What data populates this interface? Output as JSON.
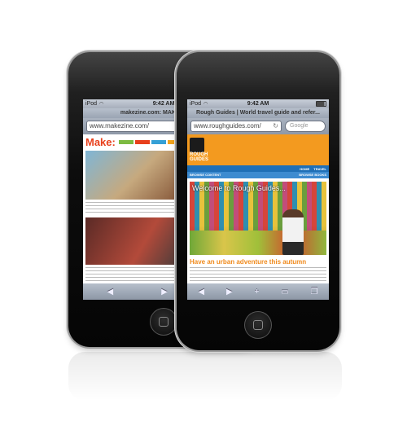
{
  "back_device": {
    "status": {
      "carrier": "iPod",
      "time": "9:42 AM"
    },
    "title": "makezine.com: MAKE: technolo",
    "url": "www.makezine.com/",
    "logo_text": "Make:"
  },
  "front_device": {
    "status": {
      "carrier": "iPod",
      "time": "9:42 AM"
    },
    "title": "Rough Guides | World travel guide and refer...",
    "url": "www.roughguides.com/",
    "search_placeholder": "Google",
    "logo_line1": "ROUGH",
    "logo_line2": "GUIDES",
    "nav": [
      "HOME",
      "TRAVEL"
    ],
    "subnav_left": "BROWSE CONTENT",
    "subnav_right": "BROWSE BOOKS",
    "welcome": "Welcome to Rough Guides...",
    "headline": "Have an urban adventure this autumn"
  },
  "toolbar_icons": [
    "back-arrow",
    "forward-arrow",
    "add",
    "bookmarks",
    "pages"
  ],
  "colors": {
    "rg_orange": "#f39a1f",
    "rg_blue": "#1f6fb6",
    "make_red": "#e8401c"
  }
}
